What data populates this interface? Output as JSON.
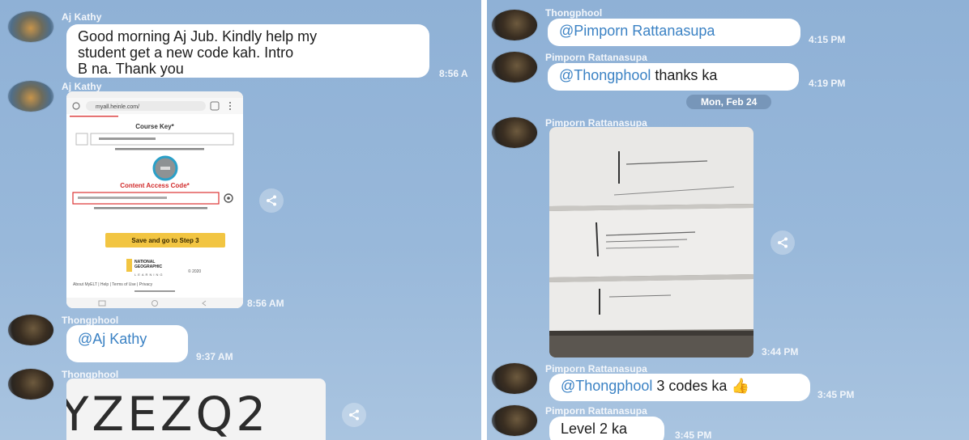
{
  "left": {
    "msg1": {
      "sender": "Aj Kathy",
      "text_line1": "Good morning Aj Jub.  Kindly help my",
      "text_line2": "student get a new code kah.  Intro",
      "text_line3": "B na.  Thank you",
      "time": "8:56 A"
    },
    "msg2": {
      "sender": "Aj Kathy",
      "time": "8:56 AM",
      "screenshot": {
        "url": "myall.heinle.com/",
        "course_key": "Course Key*",
        "content_access_code": "Content Access Code*",
        "save_button": "Save and go to Step 3",
        "logo_line1": "NATIONAL",
        "logo_line2": "GEOGRAPHIC",
        "logo_line3": "LEARNING",
        "footer_year": "© 2020",
        "footer_links": "About MyELT  |  Help  |  Terms of Use  |  Privacy"
      }
    },
    "msg3": {
      "sender": "Thongphool",
      "mention": "@Aj Kathy",
      "time": "9:37 AM"
    },
    "msg4": {
      "sender": "Thongphool",
      "code_fragment": "YZEZQ2"
    }
  },
  "right": {
    "msg1": {
      "sender": "Thongphool",
      "mention": "@Pimporn Rattanasupa",
      "time": "4:15 PM"
    },
    "msg2": {
      "sender": "Pimporn Rattanasupa",
      "mention": "@Thongphool",
      "text": " thanks ka",
      "time": "4:19 PM"
    },
    "date_divider": "Mon, Feb 24",
    "msg3": {
      "sender": "Pimporn Rattanasupa",
      "time": "3:44 PM"
    },
    "msg4": {
      "sender": "Pimporn Rattanasupa",
      "mention": "@Thongphool",
      "text": " 3 codes ka",
      "emoji": "👍",
      "time": "3:45 PM"
    },
    "msg5": {
      "sender": "Pimporn Rattanasupa",
      "text": "Level 2 ka",
      "time": "3:45 PM"
    }
  }
}
